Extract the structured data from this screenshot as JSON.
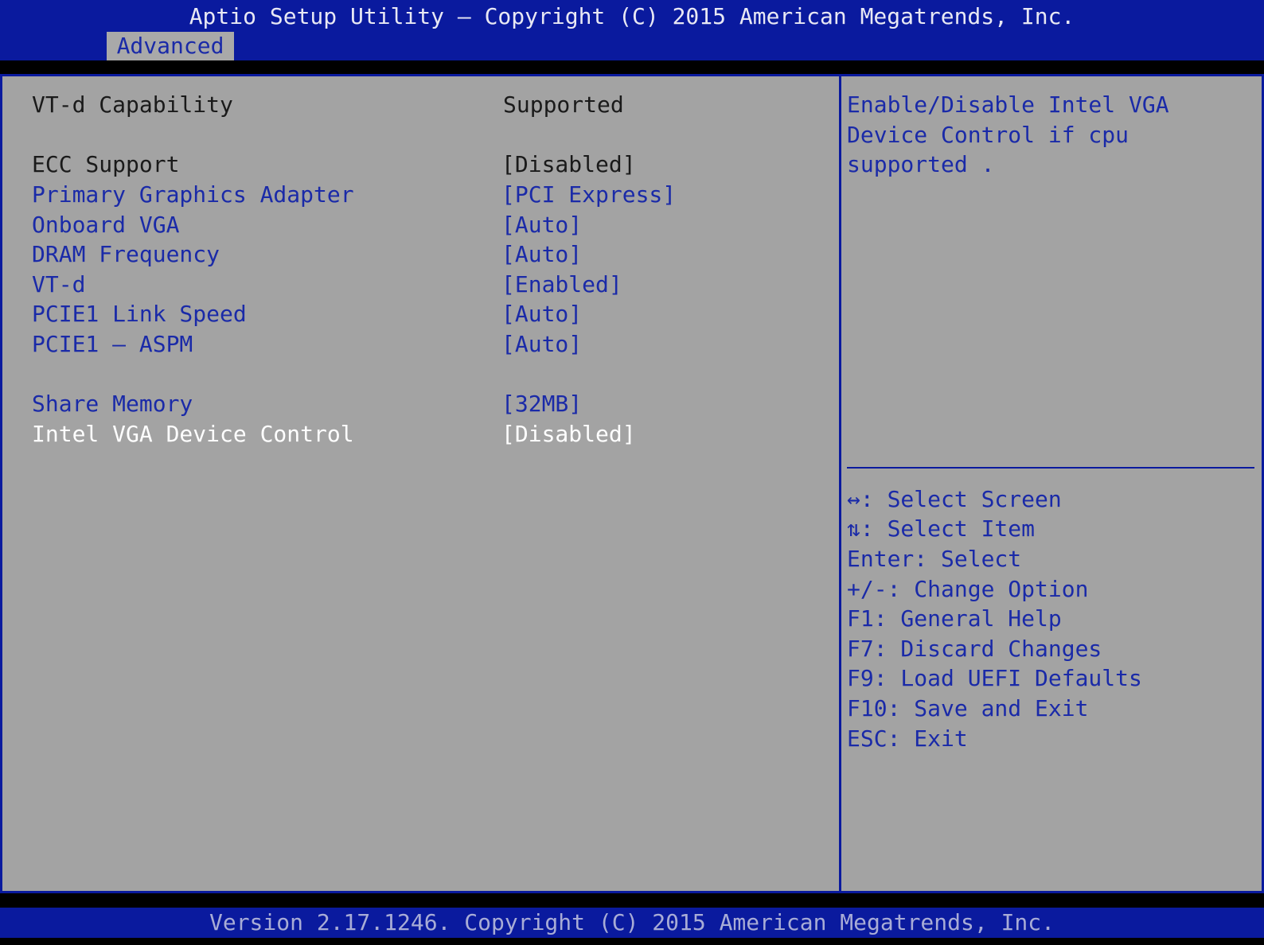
{
  "header": {
    "title": "Aptio Setup Utility – Copyright (C) 2015 American Megatrends, Inc.",
    "tabs": [
      {
        "label": "Advanced"
      }
    ]
  },
  "settings": {
    "info": {
      "label": "VT-d Capability",
      "value": "Supported"
    },
    "static": {
      "label": "ECC Support",
      "value": "[Disabled]"
    },
    "items": [
      {
        "label": "Primary Graphics Adapter",
        "value": "[PCI Express]"
      },
      {
        "label": "Onboard VGA",
        "value": "[Auto]"
      },
      {
        "label": "DRAM Frequency",
        "value": "[Auto]"
      },
      {
        "label": "VT-d",
        "value": "[Enabled]"
      },
      {
        "label": "PCIE1 Link Speed",
        "value": "[Auto]"
      },
      {
        "label": "PCIE1 – ASPM",
        "value": "[Auto]"
      },
      {
        "label": "Share Memory",
        "value": "[32MB]"
      },
      {
        "label": "Intel VGA Device Control",
        "value": "[Disabled]"
      }
    ]
  },
  "help": {
    "description": [
      "Enable/Disable Intel VGA",
      "Device Control if cpu",
      "supported ."
    ],
    "keys": [
      "↔: Select Screen",
      "⇅: Select Item",
      "Enter: Select",
      "+/-: Change Option",
      "F1: General Help",
      "F7: Discard Changes",
      "F9: Load UEFI Defaults",
      "F10: Save and Exit",
      "ESC: Exit"
    ]
  },
  "footer": {
    "text": "Version 2.17.1246. Copyright (C) 2015 American Megatrends, Inc."
  },
  "colors": {
    "header_blue": "#0a1a9e",
    "panel_gray": "#a3a3a3",
    "option_blue": "#1a2aa8",
    "selected_white": "#ffffff"
  }
}
